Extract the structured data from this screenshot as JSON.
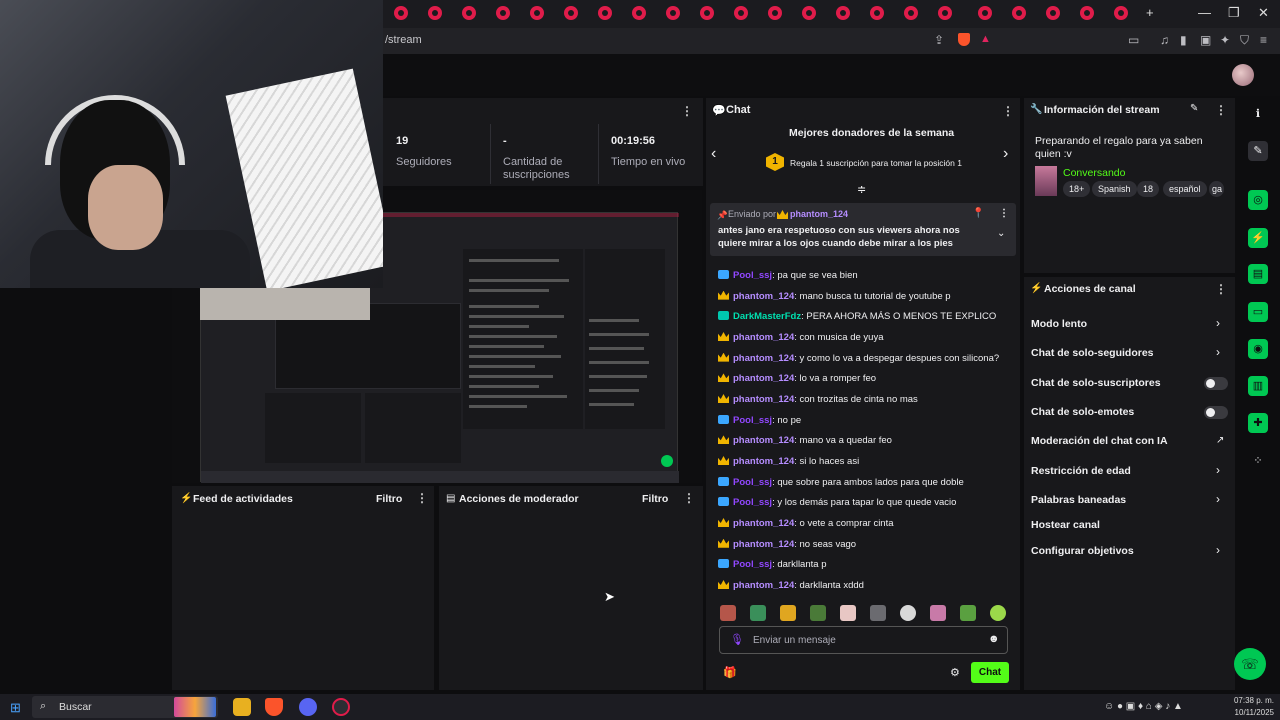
{
  "browser": {
    "url": "/stream",
    "tab_count_marker": "[",
    "new_tab": "+",
    "min": "—",
    "restore": "❐",
    "close": "✕"
  },
  "stream_stats": {
    "followers_value": "19",
    "followers_label": "Seguidores",
    "subs_value": "-",
    "subs_label": "Cantidad de suscripciones",
    "time_value": "00:19:56",
    "time_label": "Tiempo en vivo"
  },
  "activity_feed": {
    "title": "Feed de actividades",
    "filter": "Filtro"
  },
  "mod_actions": {
    "title": "Acciones de moderador",
    "filter": "Filtro"
  },
  "chat": {
    "title": "Chat",
    "donors_title": "Mejores donadores de la semana",
    "donors_rank": "1",
    "donors_text": "Regala 1 suscripción para tomar la posición 1",
    "pinned_sent_by": "Enviado por",
    "pinned_user": "phantom_124",
    "pinned_message": "antes jano era respetuoso con sus viewers ahora nos quiere mirar a los ojos cuando debe mirar a los pies",
    "messages": [
      {
        "user": "Pool_ssj",
        "text": ": pa que se vea bien",
        "badge": "blue",
        "ucls": "u-pool"
      },
      {
        "user": "phantom_124",
        "text": ": mano busca tu tutorial de youtube p",
        "badge": "crown",
        "ucls": "u-phantom"
      },
      {
        "user": "DarkMasterFdz",
        "text": ": PERA AHORA MÁS O MENOS TE EXPLICO",
        "badge": "green",
        "ucls": "u-dark"
      },
      {
        "user": "phantom_124",
        "text": ": con musica de yuya",
        "badge": "crown",
        "ucls": "u-phantom"
      },
      {
        "user": "phantom_124",
        "text": ": y como lo va a despegar despues con silicona?",
        "badge": "crown",
        "ucls": "u-phantom"
      },
      {
        "user": "phantom_124",
        "text": ": lo va a romper feo",
        "badge": "crown",
        "ucls": "u-phantom"
      },
      {
        "user": "phantom_124",
        "text": ": con trozitas de cinta no mas",
        "badge": "crown",
        "ucls": "u-phantom"
      },
      {
        "user": "Pool_ssj",
        "text": ": no pe",
        "badge": "blue",
        "ucls": "u-pool"
      },
      {
        "user": "phantom_124",
        "text": ": mano va a quedar feo",
        "badge": "crown",
        "ucls": "u-phantom"
      },
      {
        "user": "phantom_124",
        "text": ": si lo haces asi",
        "badge": "crown",
        "ucls": "u-phantom"
      },
      {
        "user": "Pool_ssj",
        "text": ": que sobre para ambos lados para que doble",
        "badge": "blue",
        "ucls": "u-pool"
      },
      {
        "user": "Pool_ssj",
        "text": ": y los demás para tapar lo que quede vacio",
        "badge": "blue",
        "ucls": "u-pool"
      },
      {
        "user": "phantom_124",
        "text": ": o vete a comprar cinta",
        "badge": "crown",
        "ucls": "u-phantom"
      },
      {
        "user": "phantom_124",
        "text": ": no seas vago",
        "badge": "crown",
        "ucls": "u-phantom"
      },
      {
        "user": "Pool_ssj",
        "text": ": darkllanta p",
        "badge": "blue",
        "ucls": "u-pool"
      },
      {
        "user": "phantom_124",
        "text": ": darkllanta xddd",
        "badge": "crown",
        "ucls": "u-phantom"
      }
    ],
    "input_placeholder": "Enviar un mensaje",
    "send_button": "Chat"
  },
  "stream_info": {
    "title": "Información del stream",
    "stream_title": "Preparando el regalo para ya saben quien :v",
    "category": "Conversando",
    "tags": [
      "18+",
      "Spanish",
      "18",
      "español",
      "ga"
    ]
  },
  "channel_actions": {
    "title": "Acciones de canal",
    "items": [
      {
        "label": "Modo lento",
        "control": "chevron"
      },
      {
        "label": "Chat de solo-seguidores",
        "control": "chevron"
      },
      {
        "label": "Chat de solo-suscriptores",
        "control": "toggle"
      },
      {
        "label": "Chat de solo-emotes",
        "control": "toggle"
      },
      {
        "label": "Moderación del chat con IA",
        "control": "external"
      },
      {
        "label": "Restricción de edad",
        "control": "chevron"
      },
      {
        "label": "Palabras baneadas",
        "control": "chevron"
      },
      {
        "label": "Hostear canal",
        "control": "none"
      },
      {
        "label": "Configurar objetivos",
        "control": "chevron"
      }
    ]
  },
  "taskbar": {
    "search": "Buscar",
    "time": "07:38 p. m.",
    "date": "10/11/2025"
  },
  "colors": {
    "accent_green": "#53fc18",
    "kick_green": "#00c853",
    "crown": "#f0b400"
  }
}
